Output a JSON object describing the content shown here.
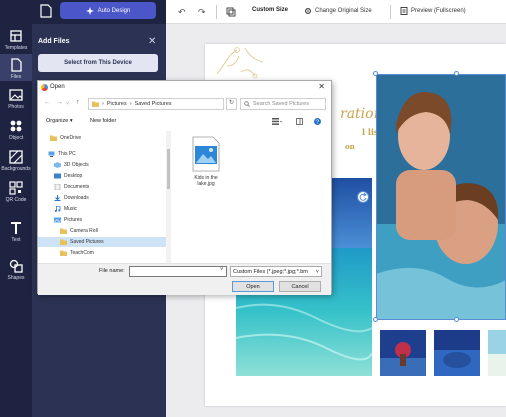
{
  "rail": {
    "items": [
      {
        "label": "Templates",
        "icon": "templates-icon"
      },
      {
        "label": "Files",
        "icon": "files-icon"
      },
      {
        "label": "Photos",
        "icon": "photos-icon"
      },
      {
        "label": "Object",
        "icon": "object-icon"
      },
      {
        "label": "Backgrounds",
        "icon": "backgrounds-icon"
      },
      {
        "label": "QR Code",
        "icon": "qr-code-icon"
      },
      {
        "label": "Text",
        "icon": "text-icon"
      },
      {
        "label": "Shapes",
        "icon": "shapes-icon"
      }
    ]
  },
  "panel": {
    "auto_design_label": "Auto Design",
    "title": "Add Files",
    "close_glyph": "✕",
    "select_button": "Select from This Device"
  },
  "toolbar": {
    "undo_glyph": "↶",
    "redo_glyph": "↷",
    "custom_size": "Custom Size",
    "change_size": "Change Original Size",
    "preview": "Preview (Fullscreen)"
  },
  "canvas": {
    "script_text": "ration",
    "list_text": "l list",
    "on_text": "on"
  },
  "dialog": {
    "title": "Open",
    "close_glyph": "✕",
    "breadcrumb": [
      "Pictures",
      "Saved Pictures"
    ],
    "search_placeholder": "Search Saved Pictures",
    "organize": "Organize ▾",
    "new_folder": "New folder",
    "nav_items": [
      {
        "label": "OneDrive",
        "type": "folder",
        "level": 0
      },
      {
        "label": "This PC",
        "type": "pc",
        "level": 0
      },
      {
        "label": "3D Objects",
        "type": "folder",
        "level": 1
      },
      {
        "label": "Desktop",
        "type": "folder",
        "level": 1
      },
      {
        "label": "Documents",
        "type": "folder",
        "level": 1
      },
      {
        "label": "Downloads",
        "type": "download",
        "level": 1
      },
      {
        "label": "Music",
        "type": "music",
        "level": 1
      },
      {
        "label": "Pictures",
        "type": "folder",
        "level": 1
      },
      {
        "label": "Camera Roll",
        "type": "folder",
        "level": 2
      },
      {
        "label": "Saved Pictures",
        "type": "folder",
        "level": 2,
        "selected": true
      },
      {
        "label": "TeachCom",
        "type": "folder",
        "level": 2
      }
    ],
    "file": {
      "label": "Kids in the lake.jpg"
    },
    "filename_label": "File name:",
    "filename_value": "",
    "filetype": "Custom Files (*.jpeg;*.jpg;*.bm",
    "open_button": "Open",
    "cancel_button": "Cancel"
  }
}
